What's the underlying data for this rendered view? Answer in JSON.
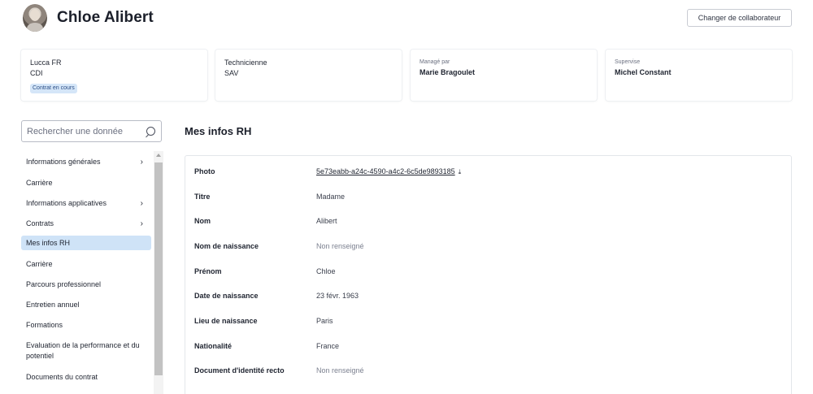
{
  "header": {
    "name": "Chloe Alibert",
    "change_button": "Changer de collaborateur"
  },
  "cards": [
    {
      "line1": "Lucca FR",
      "line2": "CDI",
      "badge": "Contrat en cours"
    },
    {
      "line1": "Technicienne",
      "line2": "SAV"
    },
    {
      "caption": "Managé par",
      "value": "Marie Bragoulet"
    },
    {
      "caption": "Supervise",
      "value": "Michel Constant"
    }
  ],
  "search": {
    "placeholder": "Rechercher une donnée"
  },
  "sidebar": {
    "items": [
      {
        "label": "Informations générales",
        "chevron": "›"
      },
      {
        "label": "Carrière"
      },
      {
        "label": "Informations applicatives",
        "chevron": "›"
      },
      {
        "label": "Contrats",
        "chevron": "›"
      },
      {
        "label": "Mes infos RH",
        "active": true
      },
      {
        "label": "Carrière"
      },
      {
        "label": "Parcours professionnel"
      },
      {
        "label": "Entretien annuel"
      },
      {
        "label": "Formations"
      },
      {
        "label": "Evaluation de la performance et du potentiel"
      },
      {
        "label": "Documents du contrat"
      }
    ]
  },
  "main": {
    "title": "Mes infos RH",
    "rows": [
      {
        "label": "Photo",
        "value": "5e73eabb-a24c-4590-a4c2-6c5de9893185",
        "download_icon": "⤓"
      },
      {
        "label": "Titre",
        "value": "Madame"
      },
      {
        "label": "Nom",
        "value": "Alibert"
      },
      {
        "label": "Nom de naissance",
        "value": "Non renseigné"
      },
      {
        "label": "Prénom",
        "value": "Chloe"
      },
      {
        "label": "Date de naissance",
        "value": "23 févr. 1963"
      },
      {
        "label": "Lieu de naissance",
        "value": "Paris"
      },
      {
        "label": "Nationalité",
        "value": "France"
      },
      {
        "label": "Document d'identité recto",
        "value": "Non renseigné"
      }
    ]
  }
}
